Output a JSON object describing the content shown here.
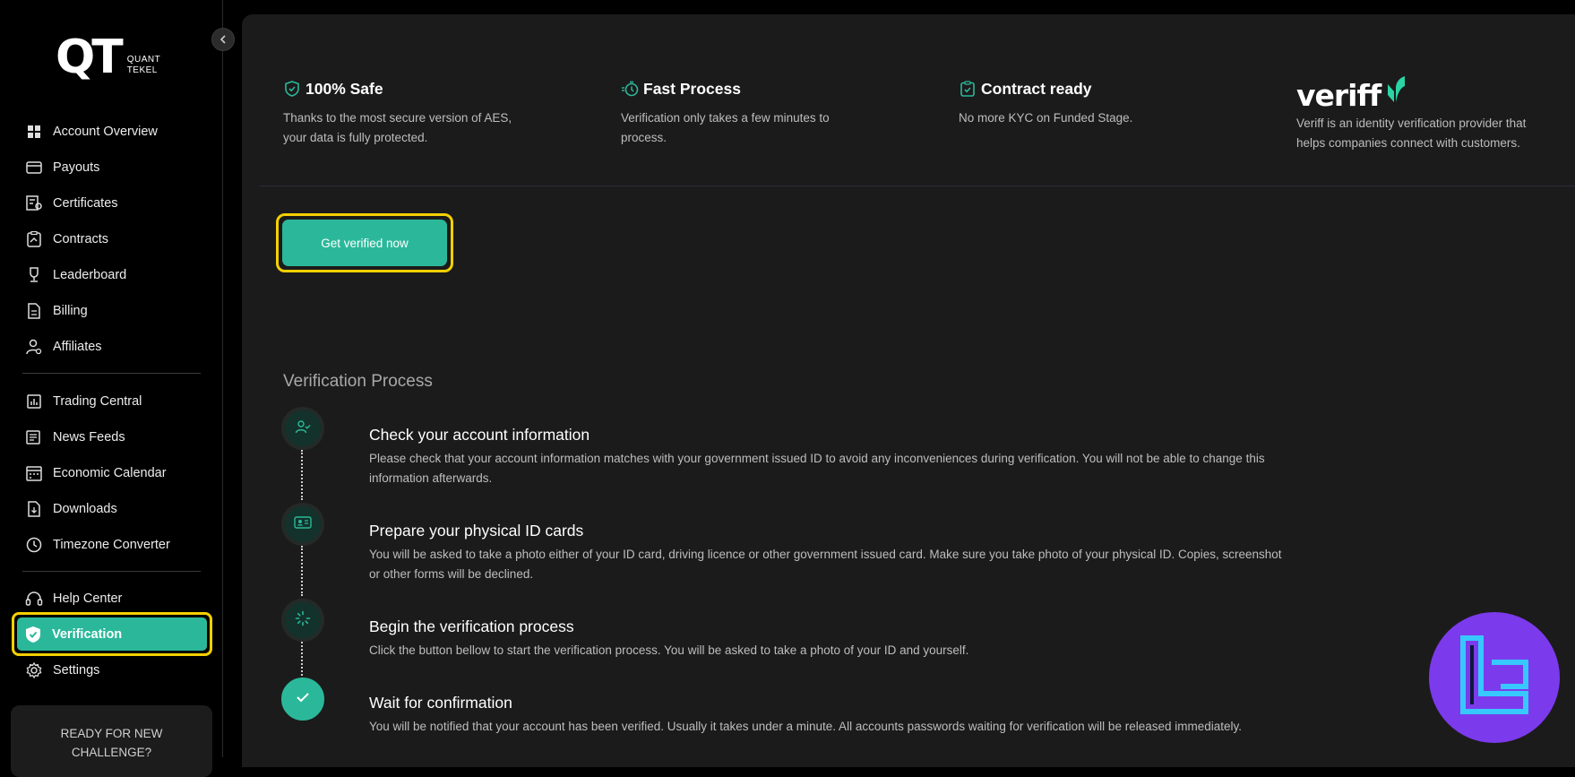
{
  "brand": {
    "mark": "QT",
    "sub_line1": "QUANT",
    "sub_line2": "TEKEL"
  },
  "sidebar": {
    "items": [
      {
        "label": "Account Overview",
        "icon": "grid-icon"
      },
      {
        "label": "Payouts",
        "icon": "card-icon"
      },
      {
        "label": "Certificates",
        "icon": "certificate-icon"
      },
      {
        "label": "Contracts",
        "icon": "contract-icon"
      },
      {
        "label": "Leaderboard",
        "icon": "trophy-icon"
      },
      {
        "label": "Billing",
        "icon": "billing-icon"
      },
      {
        "label": "Affiliates",
        "icon": "affiliates-icon"
      },
      {
        "label": "Trading Central",
        "icon": "chart-icon"
      },
      {
        "label": "News Feeds",
        "icon": "news-icon"
      },
      {
        "label": "Economic Calendar",
        "icon": "calendar-icon"
      },
      {
        "label": "Downloads",
        "icon": "download-icon"
      },
      {
        "label": "Timezone Converter",
        "icon": "clock-icon"
      },
      {
        "label": "Help Center",
        "icon": "headset-icon"
      },
      {
        "label": "Verification",
        "icon": "shield-check-icon",
        "active": true
      },
      {
        "label": "Settings",
        "icon": "gear-icon"
      }
    ],
    "challenge_card": {
      "line1": "READY FOR NEW",
      "line2": "CHALLENGE?"
    }
  },
  "features": [
    {
      "title": "100% Safe",
      "line1": "Thanks to the most secure version of AES,",
      "line2": "your data is fully protected.",
      "icon": "shield-icon"
    },
    {
      "title": "Fast Process",
      "line1": "Verification only takes a few minutes to",
      "line2": "process.",
      "icon": "stopwatch-icon"
    },
    {
      "title": "Contract ready",
      "line1": "No more KYC on Funded Stage.",
      "line2": "",
      "icon": "clipboard-check-icon"
    }
  ],
  "veriff": {
    "logo_text": "veriff",
    "line1": "Veriff is an identity verification provider that",
    "line2": "helps companies connect with customers."
  },
  "cta": {
    "label": "Get verified now"
  },
  "process": {
    "title": "Verification Process",
    "steps": [
      {
        "title": "Check your account information",
        "desc_line1": "Please check that your account information matches with your government issued ID to avoid any inconveniences during verification. You will not be able to change this",
        "desc_line2": "information afterwards.",
        "icon": "user-check-icon"
      },
      {
        "title": "Prepare your physical ID cards",
        "desc_line1": "You will be asked to take a photo either of your ID card, driving licence or other government issued card. Make sure you take photo of your physical ID. Copies, screenshot",
        "desc_line2": "or other forms will be declined.",
        "icon": "id-card-icon"
      },
      {
        "title": "Begin the verification process",
        "desc_line1": "Click the button bellow to start the verification process. You will be asked to take a photo of your ID and yourself.",
        "desc_line2": "",
        "icon": "loader-icon"
      },
      {
        "title": "Wait for confirmation",
        "desc_line1": "You will be notified that your account has been verified. Usually it takes under a minute. All accounts passwords waiting for verification will be released immediately.",
        "desc_line2": "",
        "icon": "check-icon"
      }
    ]
  },
  "colors": {
    "accent": "#2bb89a",
    "highlight": "#f5d000",
    "background": "#1b1b1b",
    "sidebar": "#000000",
    "watermark": "#7c3aed"
  }
}
